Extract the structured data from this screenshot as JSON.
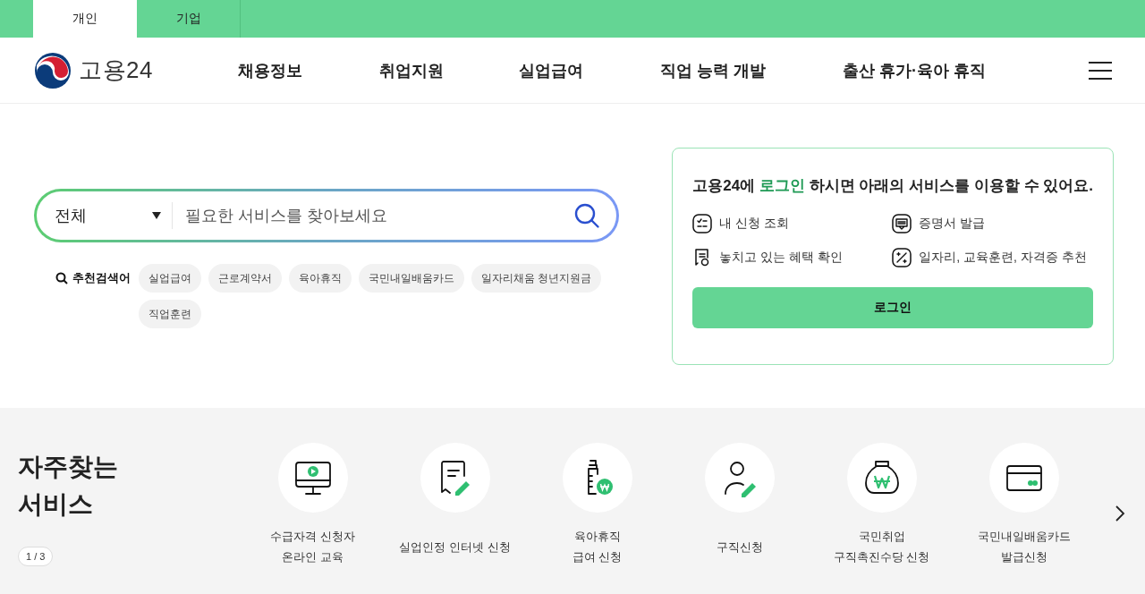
{
  "audience_tabs": [
    {
      "label": "개인",
      "selected": true
    },
    {
      "label": "기업",
      "selected": false
    }
  ],
  "header": {
    "logo_text": "고용24",
    "nav": [
      "채용정보",
      "취업지원",
      "실업급여",
      "직업 능력 개발",
      "출산 휴가·육아 휴직"
    ]
  },
  "search": {
    "category": "전체",
    "placeholder": "필요한 서비스를 찾아보세요"
  },
  "recommended": {
    "label": "추천검색어",
    "keywords": [
      "실업급여",
      "근로계약서",
      "육아휴직",
      "국민내일배움카드",
      "일자리채움 청년지원금",
      "직업훈련"
    ]
  },
  "login_card": {
    "message_before": "고용24에 ",
    "message_highlight": "로그인",
    "message_after": " 하시면 아래의 서비스를 이용할 수 있어요.",
    "features": [
      {
        "kind": "checklist",
        "label": "내 신청 조회"
      },
      {
        "kind": "certificate",
        "label": "증명서 발급"
      },
      {
        "kind": "receipt",
        "label": "놓치고 있는 혜택 확인"
      },
      {
        "kind": "magic",
        "label": "일자리, 교육훈련, 자격증 추천"
      }
    ],
    "button": "로그인"
  },
  "frequent_services": {
    "title_lines": [
      "자주찾는",
      "서비스"
    ],
    "pager": "1 / 3",
    "items": [
      {
        "kind": "monitor",
        "lines": [
          "수급자격 신청자",
          "온라인 교육"
        ]
      },
      {
        "kind": "document",
        "lines": [
          "실업인정 인터넷 신청"
        ]
      },
      {
        "kind": "bottle",
        "lines": [
          "육아휴직",
          "급여 신청"
        ]
      },
      {
        "kind": "person",
        "lines": [
          "구직신청"
        ]
      },
      {
        "kind": "moneybag",
        "lines": [
          "국민취업",
          "구직촉진수당 신청"
        ]
      },
      {
        "kind": "card",
        "lines": [
          "국민내일배움카드",
          "발급신청"
        ]
      }
    ]
  }
}
